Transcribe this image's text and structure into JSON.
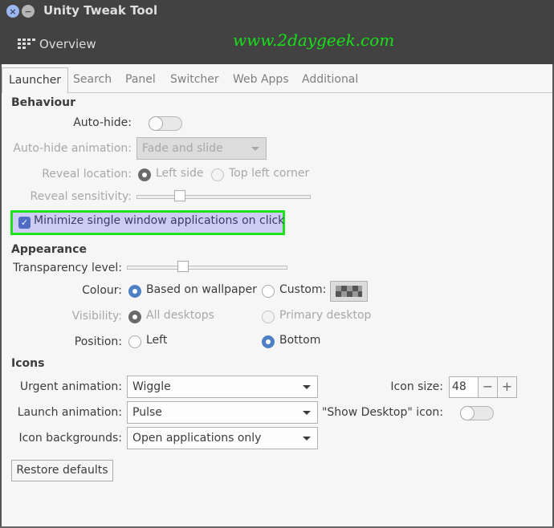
{
  "window": {
    "title": "Unity Tweak Tool",
    "overview_label": "Overview",
    "watermark": "www.2daygeek.com"
  },
  "tabs": [
    {
      "label": "Launcher",
      "active": true
    },
    {
      "label": "Search",
      "active": false
    },
    {
      "label": "Panel",
      "active": false
    },
    {
      "label": "Switcher",
      "active": false
    },
    {
      "label": "Web Apps",
      "active": false
    },
    {
      "label": "Additional",
      "active": false
    }
  ],
  "behaviour": {
    "heading": "Behaviour",
    "autohide_label": "Auto-hide:",
    "autohide_on": false,
    "autohide_animation_label": "Auto-hide animation:",
    "autohide_animation_value": "Fade and slide",
    "reveal_location_label": "Reveal location:",
    "reveal_options": [
      "Left side",
      "Top left corner"
    ],
    "reveal_selected": "Left side",
    "reveal_sensitivity_label": "Reveal sensitivity:",
    "reveal_sensitivity_value": 0.25,
    "minimize_label": "Minimize single window applications on click",
    "minimize_checked": true
  },
  "appearance": {
    "heading": "Appearance",
    "transparency_label": "Transparency level:",
    "transparency_value": 0.35,
    "colour_label": "Colour:",
    "colour_options": [
      "Based on wallpaper",
      "Custom:"
    ],
    "colour_selected": "Based on wallpaper",
    "visibility_label": "Visibility:",
    "visibility_options": [
      "All desktops",
      "Primary desktop"
    ],
    "visibility_selected": "All desktops",
    "position_label": "Position:",
    "position_options": [
      "Left",
      "Bottom"
    ],
    "position_selected": "Bottom"
  },
  "icons": {
    "heading": "Icons",
    "urgent_label": "Urgent animation:",
    "urgent_value": "Wiggle",
    "launch_label": "Launch animation:",
    "launch_value": "Pulse",
    "backgrounds_label": "Icon backgrounds:",
    "backgrounds_value": "Open applications only",
    "icon_size_label": "Icon size:",
    "icon_size_value": "48",
    "show_desktop_label": "\"Show Desktop\" icon:",
    "show_desktop_on": false
  },
  "buttons": {
    "restore_defaults": "Restore defaults",
    "spin_minus": "−",
    "spin_plus": "+",
    "close_glyph": "×",
    "minimize_glyph": "−",
    "check_glyph": "✓"
  },
  "colors": {
    "accent": "#4f7fc4",
    "highlight_border": "#1de21d",
    "highlight_fill": "#ccccf5",
    "watermark": "#18e018"
  }
}
